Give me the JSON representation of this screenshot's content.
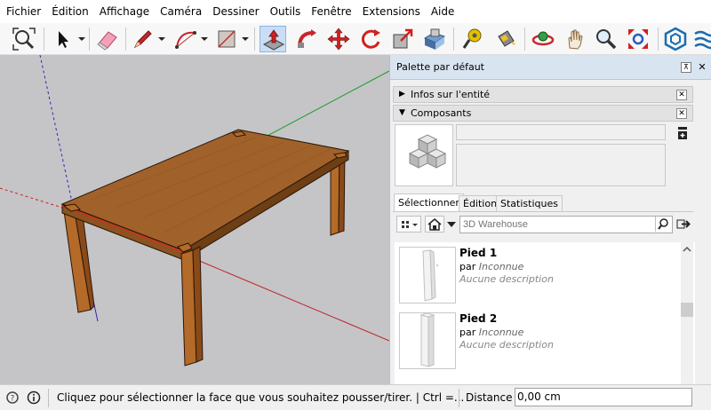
{
  "menu": [
    "Fichier",
    "Édition",
    "Affichage",
    "Caméra",
    "Dessiner",
    "Outils",
    "Fenêtre",
    "Extensions",
    "Aide"
  ],
  "toolbar": {
    "icons": [
      "zoom-extents-icon",
      "select-icon",
      "eraser-icon",
      "pencil-line-icon",
      "arc-icon",
      "rectangle-icon",
      "push-pull-icon",
      "follow-me-icon",
      "move-icon",
      "rotate-icon",
      "scale-icon",
      "offset-icon",
      "tape-measure-icon",
      "paint-bucket-icon",
      "orbit-icon",
      "pan-icon",
      "zoom-icon",
      "zoom-window-icon",
      "warehouse-icon",
      "extension-warehouse-icon"
    ],
    "active": "push-pull-icon"
  },
  "tray": {
    "title": "Palette par défaut",
    "entity_info": "Infos sur l'entité",
    "components": "Composants",
    "tabs": [
      "Sélectionner",
      "Édition",
      "Statistiques"
    ],
    "active_tab": "Sélectionner",
    "search_placeholder": "3D Warehouse",
    "items": [
      {
        "name": "Pied 1",
        "by": "par",
        "author": "Inconnue",
        "desc": "Aucune description"
      },
      {
        "name": "Pied 2",
        "by": "par",
        "author": "Inconnue",
        "desc": "Aucune description"
      }
    ]
  },
  "status": {
    "message": "Cliquez pour sélectionner la face que vous souhaitez pousser/tirer. | Ctrl =...",
    "measure_label": "Distance",
    "measure_value": "0,00 cm"
  },
  "colors": {
    "viewport_bg": "#c5c5c8",
    "wood": "#a0622a",
    "active_tool": "#c9def5",
    "tray_title_bg": "#d9e4f1"
  }
}
